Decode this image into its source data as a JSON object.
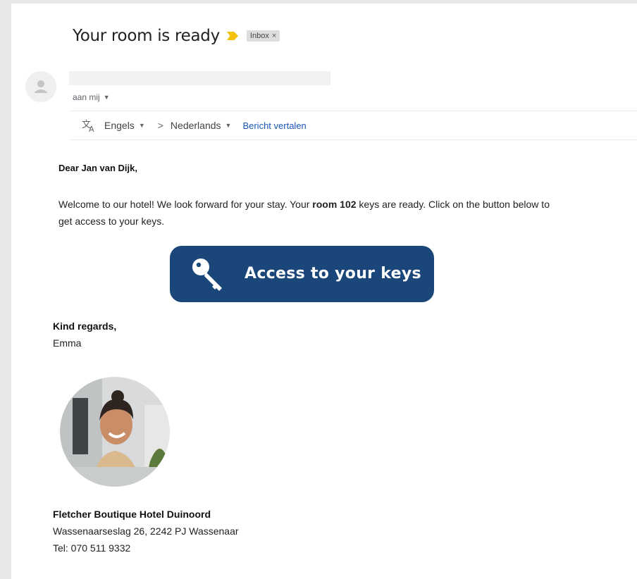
{
  "email": {
    "subject": "Your room is ready",
    "label_chip": "Inbox",
    "label_close": "×",
    "to_line": "aan mij",
    "translate": {
      "from_lang": "Engels",
      "to_lang": "Nederlands",
      "arrow": ">",
      "action": "Bericht vertalen"
    },
    "body": {
      "greeting": "Dear Jan van Dijk,",
      "para_before": "Welcome to our hotel! We look forward for your stay. Your ",
      "para_bold": "room 102",
      "para_after": " keys are ready. Click on the button below to get access to your keys.",
      "button_label": "Access to your keys",
      "closing": "Kind regards,",
      "signer": "Emma",
      "hotel_name": "Fletcher Boutique Hotel Duinoord",
      "hotel_address": "Wassenaarseslag 26, 2242 PJ Wassenaar",
      "hotel_tel": "Tel: 070 511 9332"
    }
  },
  "icons": {
    "importance": "importance-marker-icon",
    "translate": "translate-icon",
    "key": "key-icon",
    "avatar": "default-avatar-icon"
  },
  "colors": {
    "button_bg": "#1b4679",
    "importance": "#f4c20d",
    "link": "#1a57b8"
  }
}
